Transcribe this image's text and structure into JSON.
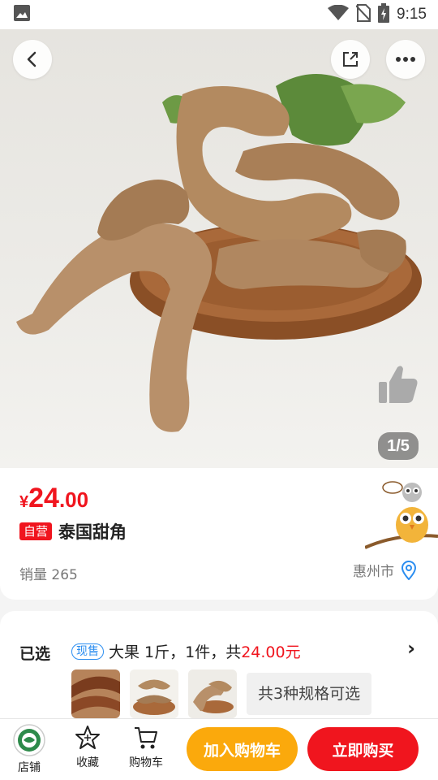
{
  "status_bar": {
    "time": "9:15",
    "icons": [
      "gallery-icon",
      "wifi-icon",
      "no-sim-icon",
      "battery-icon"
    ]
  },
  "gallery": {
    "page_indicator": "1/5",
    "current": 1,
    "total": 5
  },
  "product": {
    "price_currency": "¥",
    "price_int": "24",
    "price_dec": ".00",
    "self_tag": "自营",
    "name": "泰国甜角",
    "sales": "销量 265",
    "location": "惠州市"
  },
  "spec": {
    "label": "已选",
    "stock_tag": "现售",
    "selection_text": "大果 1斤，1件，共",
    "selection_price": "24.00元",
    "options_count": "共3种规格可选"
  },
  "bottom_bar": {
    "store_label": "店铺",
    "favorite_label": "收藏",
    "cart_label": "购物车",
    "add_to_cart": "加入购物车",
    "buy_now": "立即购买"
  },
  "colors": {
    "accent_red": "#f0151e",
    "accent_orange": "#fba90c",
    "stock_blue": "#2a8df0"
  }
}
